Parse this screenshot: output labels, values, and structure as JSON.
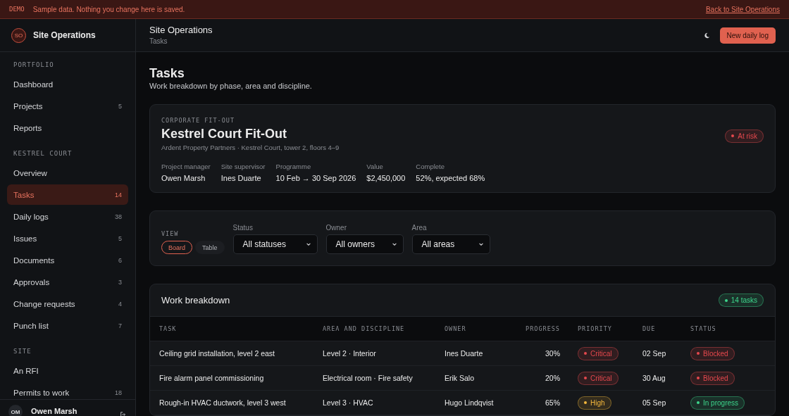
{
  "banner": {
    "tag": "DEMO",
    "message": "Sample data. Nothing you change here is saved.",
    "link": "Back to Site Operations"
  },
  "sidebar": {
    "brand": {
      "initials": "SO",
      "name": "Site Operations"
    },
    "sections": [
      {
        "title": "PORTFOLIO",
        "items": [
          {
            "label": "Dashboard",
            "selected": false
          },
          {
            "label": "Projects",
            "count": "5",
            "selected": false
          },
          {
            "label": "Reports",
            "selected": false
          }
        ]
      },
      {
        "title": "KESTREL COURT",
        "items": [
          {
            "label": "Overview",
            "selected": false
          },
          {
            "label": "Tasks",
            "count": "14",
            "selected": true
          },
          {
            "label": "Daily logs",
            "count": "38",
            "selected": false
          },
          {
            "label": "Issues",
            "count": "5",
            "selected": false
          },
          {
            "label": "Documents",
            "count": "6",
            "selected": false
          },
          {
            "label": "Approvals",
            "count": "3",
            "selected": false
          },
          {
            "label": "Change requests",
            "count": "4",
            "selected": false
          },
          {
            "label": "Punch list",
            "count": "7",
            "selected": false
          }
        ]
      },
      {
        "title": "SITE",
        "items": [
          {
            "label": "An RFI",
            "selected": false
          },
          {
            "label": "Permits to work",
            "count": "18",
            "selected": false
          }
        ]
      }
    ],
    "user": {
      "initials": "OM",
      "name": "Owen Marsh"
    }
  },
  "header": {
    "title": "Site Operations",
    "breadcrumb": "Tasks",
    "button": "New daily log"
  },
  "page": {
    "title": "Tasks",
    "subtitle": "Work breakdown by phase, area and discipline."
  },
  "project": {
    "eyebrow": "CORPORATE FIT-OUT",
    "name": "Kestrel Court Fit-Out",
    "client": "Ardent Property Partners · Kestrel Court, tower 2, floors 4–9",
    "status": {
      "label": "At risk",
      "color": "#e5484d"
    },
    "facts": [
      {
        "label": "Project manager",
        "value": "Owen Marsh"
      },
      {
        "label": "Site supervisor",
        "value": "Ines Duarte"
      },
      {
        "label": "Programme",
        "value": "10 Feb → 30 Sep 2026"
      },
      {
        "label": "Value",
        "value": "$2,450,000"
      },
      {
        "label": "Complete",
        "value": "52%, expected 68%"
      }
    ]
  },
  "filters": {
    "view_label": "VIEW",
    "views": [
      {
        "label": "Board",
        "selected": true
      },
      {
        "label": "Table",
        "selected": false
      }
    ],
    "selects": [
      {
        "label": "Status",
        "value": "All statuses"
      },
      {
        "label": "Owner",
        "value": "All owners"
      },
      {
        "label": "Area",
        "value": "All areas"
      }
    ]
  },
  "table": {
    "title": "Work breakdown",
    "count": {
      "label": "14 tasks",
      "color": "#3dd68c"
    },
    "columns": [
      "TASK",
      "AREA AND DISCIPLINE",
      "OWNER",
      "PROGRESS",
      "PRIORITY",
      "DUE",
      "STATUS"
    ],
    "rows": [
      {
        "task": "Ceiling grid installation, level 2 east",
        "area": "Level 2 · Interior",
        "owner": "Ines Duarte",
        "progress": "30%",
        "priority": {
          "label": "Critical",
          "color": "#e5484d"
        },
        "due": "02 Sep",
        "status": {
          "label": "Blocked",
          "color": "#e5484d"
        }
      },
      {
        "task": "Fire alarm panel commissioning",
        "area": "Electrical room · Fire safety",
        "owner": "Erik Salo",
        "progress": "20%",
        "priority": {
          "label": "Critical",
          "color": "#e5484d"
        },
        "due": "30 Aug",
        "status": {
          "label": "Blocked",
          "color": "#e5484d"
        }
      },
      {
        "task": "Rough-in HVAC ductwork, level 3 west",
        "area": "Level 3 · HVAC",
        "owner": "Hugo Lindqvist",
        "progress": "65%",
        "priority": {
          "label": "High",
          "color": "#f5b83d"
        },
        "due": "05 Sep",
        "status": {
          "label": "In progress",
          "color": "#3dd68c"
        }
      }
    ]
  }
}
